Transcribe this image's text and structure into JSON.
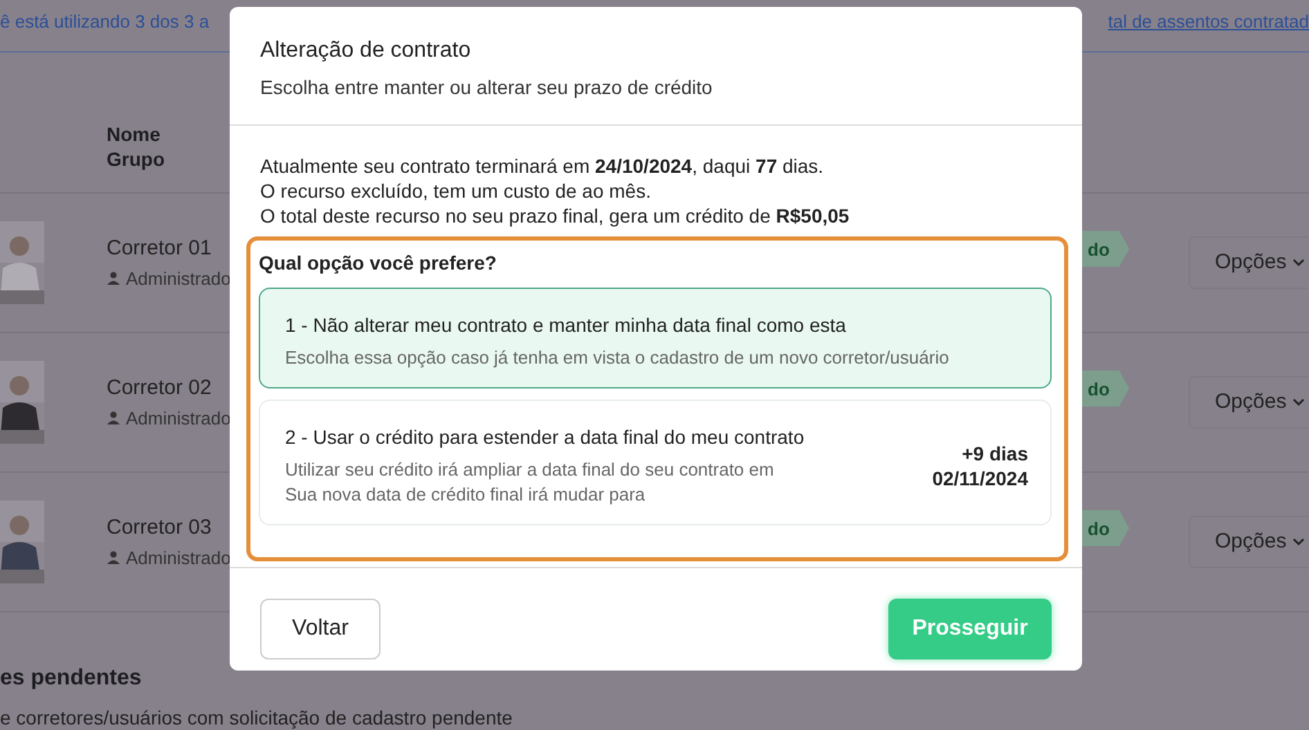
{
  "background": {
    "notice_left": "ê está utilizando 3 dos 3 a",
    "notice_right": "tal de assentos contratad",
    "columns": [
      "Nome",
      "Grupo"
    ],
    "rows": [
      {
        "name": "Corretor 01",
        "group": "Administrado",
        "status": "do",
        "action": "Opções"
      },
      {
        "name": "Corretor 02",
        "group": "Administrado",
        "status": "do",
        "action": "Opções"
      },
      {
        "name": "Corretor 03",
        "group": "Administrado",
        "status": "do",
        "action": "Opções"
      }
    ],
    "pending": {
      "title": "es pendentes",
      "text": "e corretores/usuários com solicitação de cadastro pendente"
    }
  },
  "modal": {
    "title": "Alteração de contrato",
    "subtitle": "Escolha entre manter ou alterar seu prazo de crédito",
    "info": [
      "Atualmente seu contrato terminará em **24/10/2024**, daqui **77** dias.",
      "O recurso excluído, tem um custo de ao mês.",
      "O total deste recurso no seu prazo final, gera um crédito de **R$50,05**"
    ],
    "question": "Qual opção você prefere?",
    "options": [
      {
        "title": "1 - Não alterar meu contrato e manter minha data final como esta",
        "description": [
          "Escolha essa opção caso já tenha em vista o cadastro de um novo corretor/usuário"
        ],
        "selected": true
      },
      {
        "title": "2 - Usar o crédito para estender a data final do meu contrato",
        "description": [
          "Utilizar seu crédito irá ampliar a data final do seu contrato em",
          "Sua nova data de crédito final irá mudar para"
        ],
        "extra": [
          "+9 dias",
          "02/11/2024"
        ],
        "selected": false
      }
    ],
    "buttons": [
      {
        "label": "Voltar",
        "kind": "secondary"
      },
      {
        "label": "Prosseguir",
        "kind": "primary"
      }
    ]
  }
}
